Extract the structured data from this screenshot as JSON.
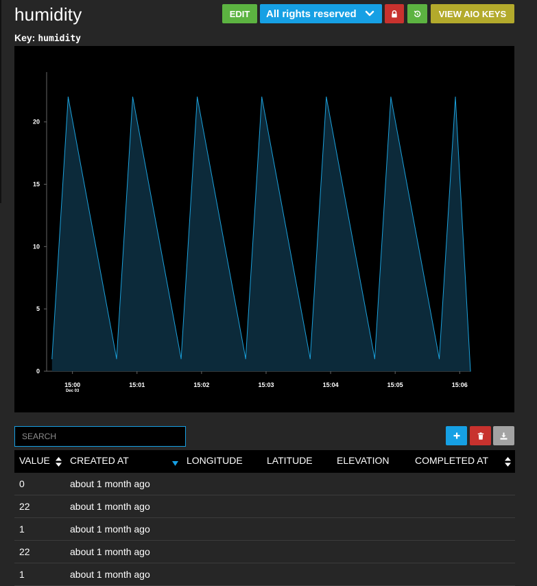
{
  "feed": {
    "title": "humidity",
    "key_label": "Key:",
    "key_value": "humidity"
  },
  "toolbar": {
    "edit_label": "EDIT",
    "license_label": "All rights reserved",
    "view_keys_label": "VIEW AIO KEYS"
  },
  "colors": {
    "edit": "#5cb341",
    "license": "#16a0e4",
    "lock": "#c8322e",
    "keys": "#b3aa2c",
    "line": "#1ba2dd",
    "area": "#0c2a3a"
  },
  "icons": {
    "license": "chevron-down-icon",
    "lock": "lock-icon",
    "reset": "reset-icon",
    "add": "plus-icon",
    "delete": "trash-icon",
    "download": "download-icon"
  },
  "chart_data": {
    "type": "area",
    "title": "",
    "xlabel": "",
    "ylabel": "",
    "ylim": [
      0,
      24
    ],
    "yticks": [
      0,
      5,
      10,
      15,
      20
    ],
    "x_range": [
      "14:59:36",
      "15:06:10"
    ],
    "xticks": [
      {
        "label": "15:00",
        "sub": "Dec 03",
        "time": "15:00:00"
      },
      {
        "label": "15:01",
        "sub": "",
        "time": "15:01:00"
      },
      {
        "label": "15:02",
        "sub": "",
        "time": "15:02:00"
      },
      {
        "label": "15:03",
        "sub": "",
        "time": "15:03:00"
      },
      {
        "label": "15:04",
        "sub": "",
        "time": "15:04:00"
      },
      {
        "label": "15:05",
        "sub": "",
        "time": "15:05:00"
      },
      {
        "label": "15:06",
        "sub": "",
        "time": "15:06:00"
      }
    ],
    "grid": false,
    "legend": "none",
    "series": [
      {
        "points": [
          {
            "x": "14:59:41",
            "y": 1
          },
          {
            "x": "14:59:56",
            "y": 22
          },
          {
            "x": "15:00:41",
            "y": 1
          },
          {
            "x": "15:00:56",
            "y": 22
          },
          {
            "x": "15:01:41",
            "y": 1
          },
          {
            "x": "15:01:56",
            "y": 22
          },
          {
            "x": "15:02:41",
            "y": 1
          },
          {
            "x": "15:02:56",
            "y": 22
          },
          {
            "x": "15:03:41",
            "y": 1
          },
          {
            "x": "15:03:56",
            "y": 22
          },
          {
            "x": "15:04:41",
            "y": 1
          },
          {
            "x": "15:04:56",
            "y": 22
          },
          {
            "x": "15:05:41",
            "y": 1
          },
          {
            "x": "15:05:56",
            "y": 22
          },
          {
            "x": "15:06:10",
            "y": 0
          }
        ]
      }
    ]
  },
  "search": {
    "placeholder": "SEARCH"
  },
  "table": {
    "columns": [
      "VALUE",
      "CREATED AT",
      "LONGITUDE",
      "LATITUDE",
      "ELEVATION",
      "COMPLETED AT"
    ],
    "rows": [
      {
        "value": "0",
        "created_at": "about 1 month ago"
      },
      {
        "value": "22",
        "created_at": "about 1 month ago"
      },
      {
        "value": "1",
        "created_at": "about 1 month ago"
      },
      {
        "value": "22",
        "created_at": "about 1 month ago"
      },
      {
        "value": "1",
        "created_at": "about 1 month ago"
      }
    ]
  }
}
